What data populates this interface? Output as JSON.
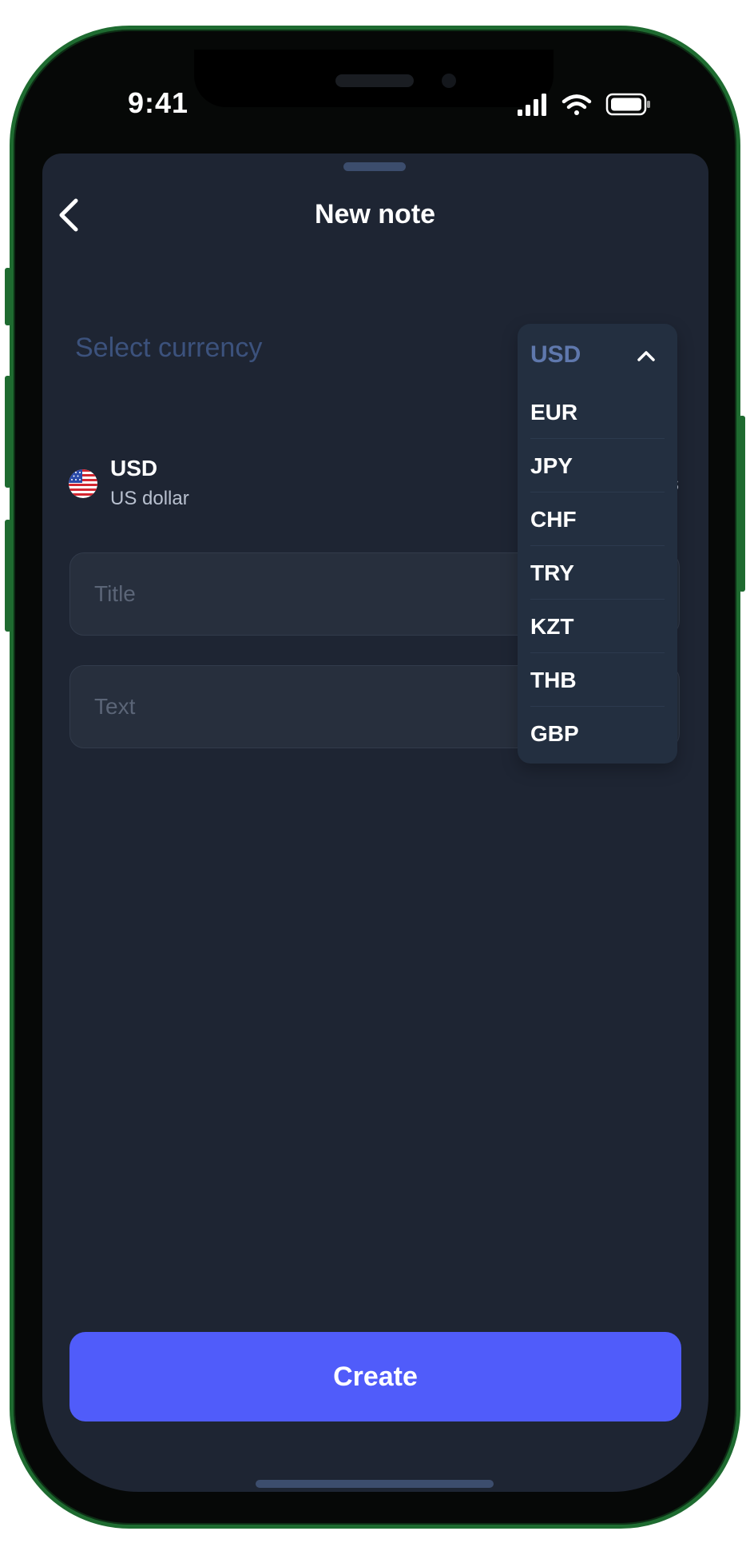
{
  "status_bar": {
    "time": "9:41"
  },
  "header": {
    "title": "New note"
  },
  "currency_select": {
    "label": "Select currency",
    "selected_code": "USD",
    "selected_name": "US dollar",
    "options": [
      "EUR",
      "JPY",
      "CHF",
      "TRY",
      "KZT",
      "THB",
      "GBP"
    ],
    "obscured_text": "s"
  },
  "form": {
    "title_placeholder": "Title",
    "text_placeholder": "Text"
  },
  "actions": {
    "create_label": "Create"
  },
  "colors": {
    "background": "#1e2533",
    "accent": "#505cfa",
    "label_muted": "#3c527d",
    "dropdown_bg": "#232f40",
    "phone_frame": "#1e6b30"
  },
  "icons": {
    "back": "chevron-left-icon",
    "dropdown": "chevron-up-icon",
    "flag": "us-flag-icon",
    "signal": "cellular-signal-icon",
    "wifi": "wifi-icon",
    "battery": "battery-icon"
  }
}
